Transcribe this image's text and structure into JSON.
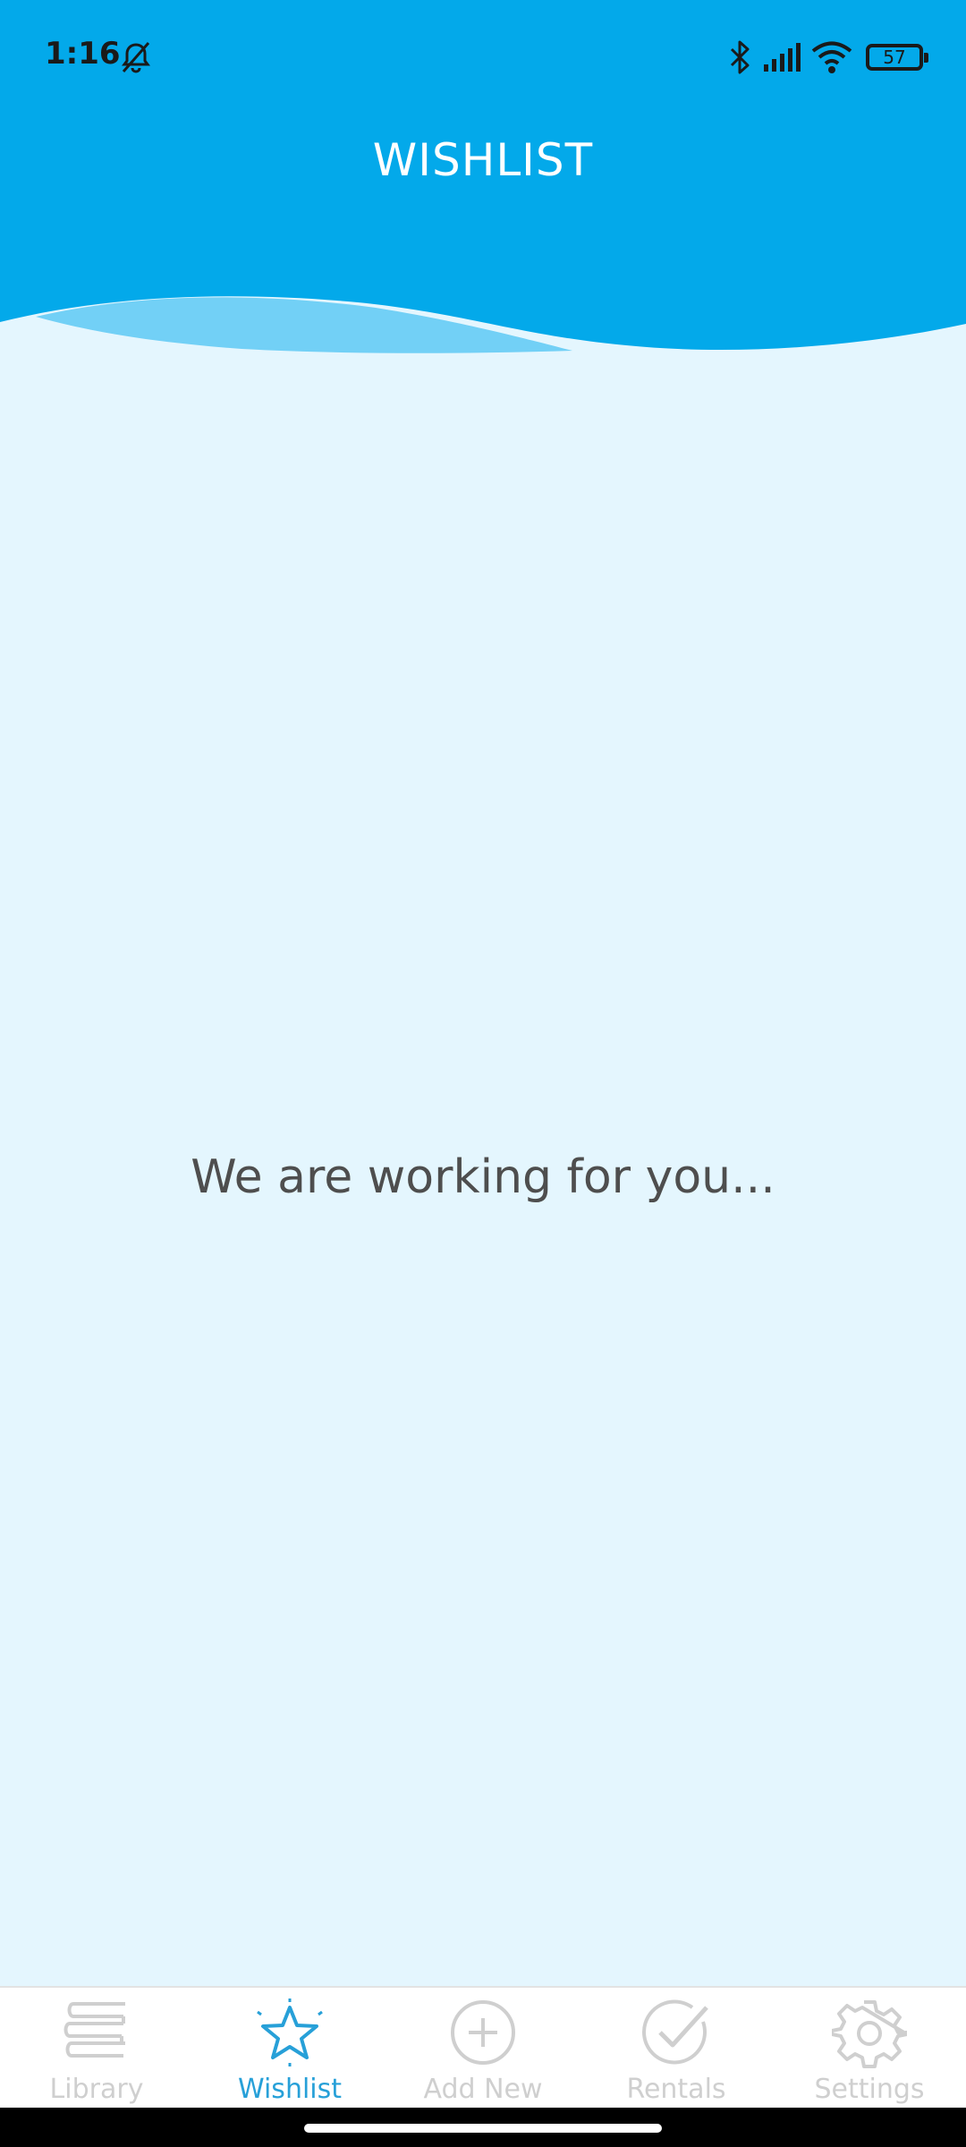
{
  "status_bar": {
    "time": "1:16",
    "battery_level": "57",
    "icons": [
      "bell-off-icon",
      "bluetooth-icon",
      "signal-icon",
      "wifi-icon",
      "battery-icon"
    ]
  },
  "header": {
    "title": "WISHLIST",
    "color": "#03a9ea"
  },
  "main": {
    "message": "We are working for you..."
  },
  "bottom_nav": {
    "items": [
      {
        "label": "Library",
        "icon": "books-icon",
        "active": false
      },
      {
        "label": "Wishlist",
        "icon": "star-icon",
        "active": true
      },
      {
        "label": "Add New",
        "icon": "plus-circle-icon",
        "active": false
      },
      {
        "label": "Rentals",
        "icon": "check-circle-icon",
        "active": false
      },
      {
        "label": "Settings",
        "icon": "gear-icon",
        "active": false
      }
    ],
    "active_color": "#27a0d8",
    "inactive_color": "#cfcfcf"
  },
  "background_color": "#e4f6fe"
}
